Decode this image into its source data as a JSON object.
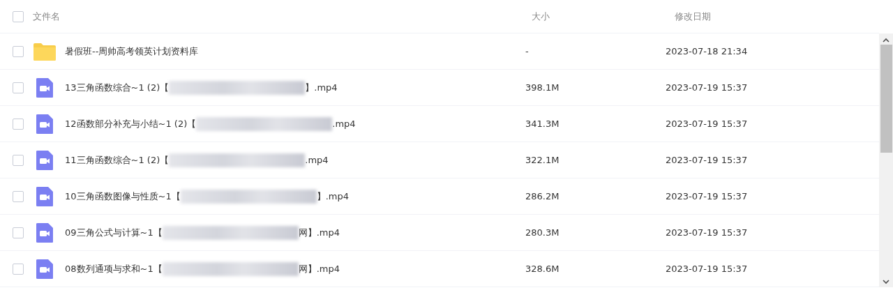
{
  "header": {
    "select_all_checked": false,
    "columns": [
      "文件名",
      "大小",
      "修改日期"
    ]
  },
  "rows": [
    {
      "kind": "folder",
      "checked": false,
      "name": "暑假班--周帅高考领英计划资料库",
      "size": "-",
      "modified": "2023-07-18 21:34"
    },
    {
      "kind": "video",
      "checked": false,
      "name": "13三角函数综合~1 (2)【",
      "redacted": true,
      "name_end": "】.mp4",
      "size": "398.1M",
      "modified": "2023-07-19 15:37"
    },
    {
      "kind": "video",
      "checked": false,
      "name": "12函数部分补充与小结~1 (2)【",
      "redacted": true,
      "name_end": ".mp4",
      "size": "341.3M",
      "modified": "2023-07-19 15:37"
    },
    {
      "kind": "video",
      "checked": false,
      "name": "11三角函数综合~1 (2)【",
      "redacted": true,
      "name_end": ".mp4",
      "size": "322.1M",
      "modified": "2023-07-19 15:37"
    },
    {
      "kind": "video",
      "checked": false,
      "name": "10三角函数图像与性质~1【",
      "redacted": true,
      "name_end": "】.mp4",
      "size": "286.2M",
      "modified": "2023-07-19 15:37"
    },
    {
      "kind": "video",
      "checked": false,
      "name": "09三角公式与计算~1【",
      "redacted": true,
      "name_end": "网】.mp4",
      "size": "280.3M",
      "modified": "2023-07-19 15:37"
    },
    {
      "kind": "video",
      "checked": false,
      "name": "08数列通项与求和~1【",
      "redacted": true,
      "name_end": "网】.mp4",
      "size": "328.6M",
      "modified": "2023-07-19 15:37"
    }
  ]
}
